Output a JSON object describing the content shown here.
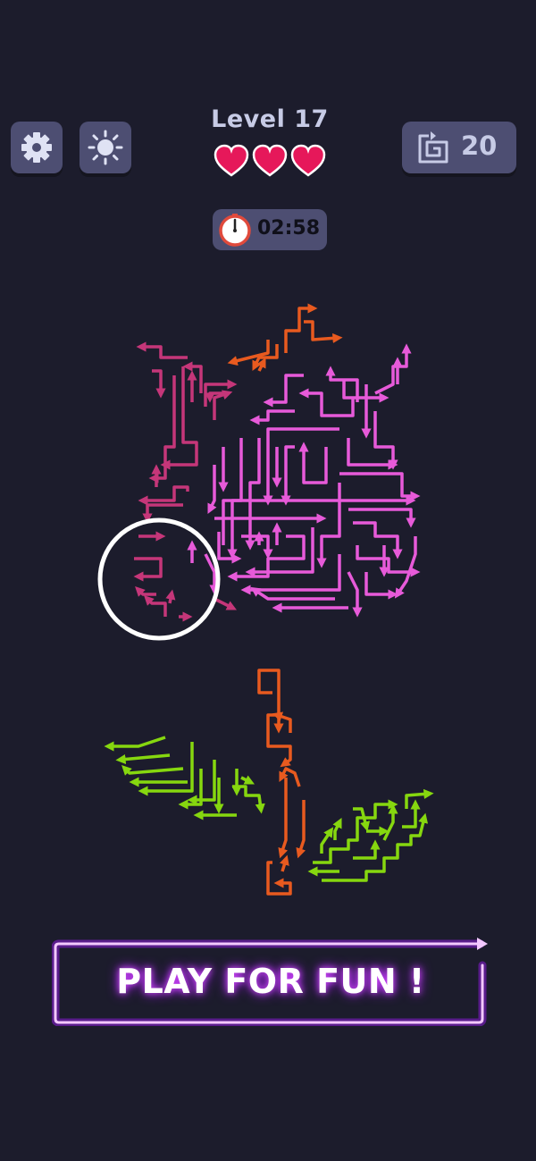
{
  "header": {
    "level_label": "Level 17",
    "lives": 3,
    "moves_left": "20",
    "timer": "02:58"
  },
  "icons": {
    "settings": "gear-icon",
    "theme": "sun-icon",
    "moves": "spiral-arrow-icon",
    "timer": "stopwatch-icon",
    "life": "heart-icon"
  },
  "colors": {
    "background": "#1c1c2c",
    "button": "#4d4e72",
    "heart": "#e6185a",
    "rose_pink": "#e75ad9",
    "rose_crimson": "#c53679",
    "stem_orange": "#e85a1f",
    "leaf_green": "#86d70f",
    "neon_purple": "#d74bff"
  },
  "cta": {
    "label": "PLAY FOR FUN !"
  }
}
